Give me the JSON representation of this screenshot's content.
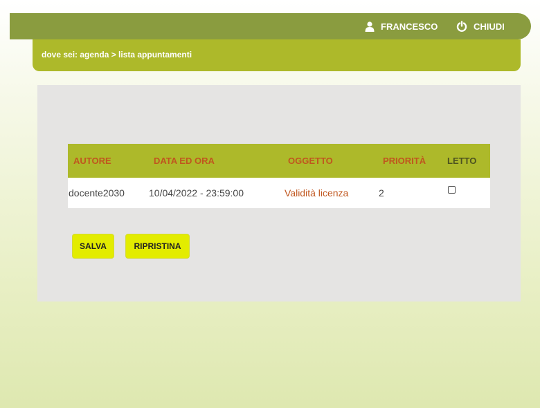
{
  "header": {
    "user_icon": "user-icon",
    "user_name": "FRANCESCO",
    "logout_icon": "power-icon",
    "logout_label": "CHIUDI"
  },
  "breadcrumb": {
    "text": "dove sei: agenda > lista appuntamenti"
  },
  "table": {
    "columns": [
      "AUTORE",
      "DATA ED ORA",
      "OGGETTO",
      "PRIORITÀ",
      "LETTO"
    ],
    "rows": [
      {
        "autore": "docente2030",
        "data_ora": "10/04/2022 - 23:59:00",
        "oggetto": "Validità licenza",
        "priorita": "2",
        "letto": false
      }
    ]
  },
  "buttons": {
    "save_label": "SALVA",
    "reset_label": "RIPRISTINA"
  },
  "colors": {
    "topbar": "#8a9c3f",
    "breadcrumb_bar": "#adb92a",
    "accent_text": "#c0561e",
    "button": "#e3ec00"
  }
}
